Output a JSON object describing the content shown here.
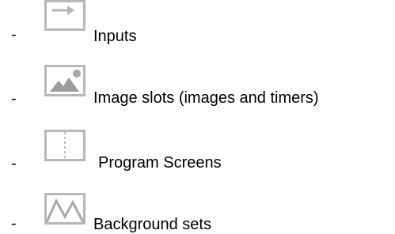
{
  "list": {
    "bullet": "-",
    "items": [
      {
        "icon": "input-arrow-icon",
        "label": "Inputs"
      },
      {
        "icon": "image-slot-icon",
        "label": "Image slots (images and timers)"
      },
      {
        "icon": "program-screen-icon",
        "label": "Program Screens"
      },
      {
        "icon": "background-set-icon",
        "label": "Background sets"
      }
    ]
  }
}
